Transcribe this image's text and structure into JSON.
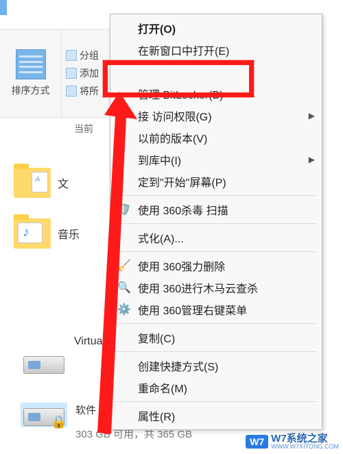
{
  "ribbon": {
    "sort_label": "排序方式",
    "group_label": "分组",
    "add_label": "添加",
    "fit_label": "将所",
    "status": "当前"
  },
  "nav": {
    "doc_partial": "文",
    "music": "音乐",
    "virtual": "Virtua",
    "software_label": "软件 (",
    "storage_line": "303 GB 可用，共 365 GB"
  },
  "ctx": {
    "open": "打开(O)",
    "open_new_window": "在新窗口中打开(E)",
    "hidden_row": "———",
    "manage_bitlocker": "管理 BitLocker(B)",
    "access_rights": "接      访问权限(G)",
    "restore_prev": "       以前的版本(V)",
    "to_library": "       到库中(I)",
    "pin_start": "      定到\"开始\"屏幕(P)",
    "scan_360av": "使用 360杀毒 扫描",
    "format": "      式化(A)...",
    "force_delete": "使用 360强力删除",
    "trojan_scan": "使用 360进行木马云查杀",
    "manage_rc_menu": "使用 360管理右键菜单",
    "copy": "复制(C)",
    "create_shortcut": "创建快捷方式(S)",
    "rename": "重命名(M)",
    "properties": "属性(R)"
  },
  "watermark": {
    "badge": "W7",
    "text": "W7系统之家",
    "url": "WWW.W7XITONG.COM"
  }
}
